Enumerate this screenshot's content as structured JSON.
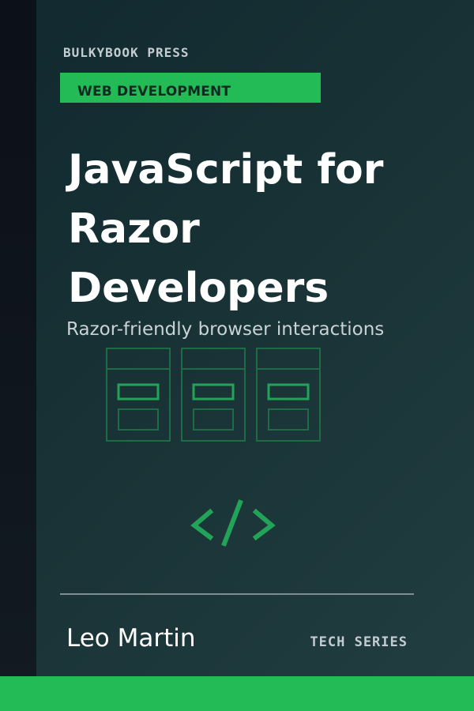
{
  "cover": {
    "publisher": "BULKYBOOK PRESS",
    "category": "WEB DEVELOPMENT",
    "title_lines": [
      "JavaScript for",
      "Razor",
      "Developers"
    ],
    "subtitle": "Razor-friendly browser interactions",
    "author": "Leo Martin",
    "series": "TECH SERIES"
  },
  "colors": {
    "accent": "#22bb55",
    "background": "#1a3437",
    "spine": "#0c1018",
    "title_text": "#ffffff",
    "muted_text": "#c3ccd2"
  },
  "icons": [
    "web-page-wireframe-icon",
    "code-brackets-icon"
  ]
}
